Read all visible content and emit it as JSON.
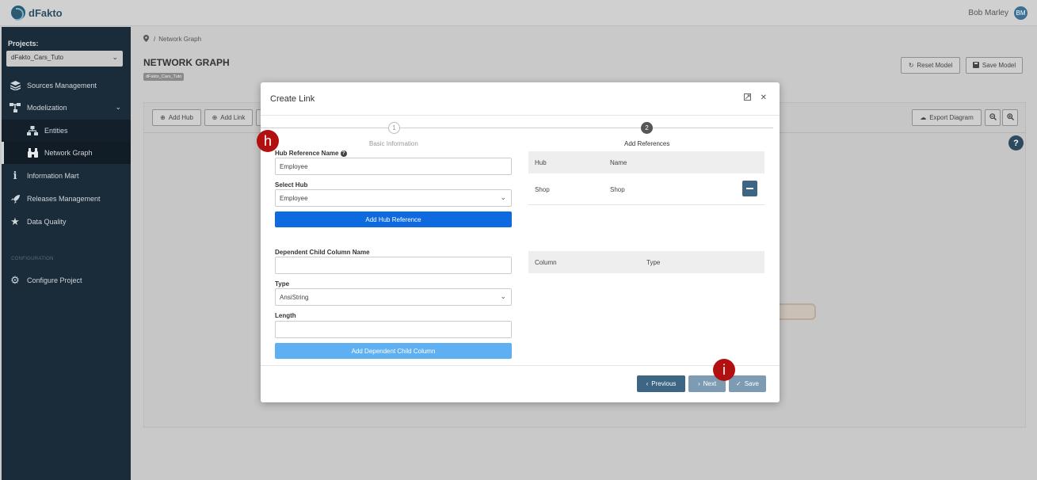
{
  "app": {
    "logo_text": "dFakto"
  },
  "user": {
    "name": "Bob Marley",
    "initials": "BM"
  },
  "sidebar": {
    "projects_label": "Projects:",
    "project_selected": "dFakto_Cars_Tuto",
    "items": [
      {
        "label": "Sources Management",
        "icon": "layers-icon"
      },
      {
        "label": "Modelization",
        "icon": "hierarchy-icon"
      },
      {
        "label": "Entities",
        "icon": "sitemap-icon"
      },
      {
        "label": "Network Graph",
        "icon": "binoculars-icon"
      },
      {
        "label": "Information Mart",
        "icon": "info-icon"
      },
      {
        "label": "Releases Management",
        "icon": "rocket-icon"
      },
      {
        "label": "Data Quality",
        "icon": "star-icon"
      }
    ],
    "section_label": "CONFIGURATION",
    "configure_label": "Configure Project"
  },
  "header": {
    "breadcrumb": "Network Graph",
    "title": "NETWORK GRAPH",
    "project_badge": "dFakto_Cars_Tuto",
    "reset_label": "Reset Model",
    "save_label": "Save Model"
  },
  "toolbar": {
    "add_hub": "Add Hub",
    "add_link": "Add Link",
    "export": "Export Diagram"
  },
  "modal": {
    "title": "Create Link",
    "steps": [
      {
        "num": "1",
        "label": "Basic Information"
      },
      {
        "num": "2",
        "label": "Add References"
      }
    ],
    "hub_ref_label": "Hub Reference Name",
    "hub_ref_value": "Employee",
    "select_hub_label": "Select Hub",
    "select_hub_value": "Employee",
    "add_hub_ref_btn": "Add Hub Reference",
    "dep_child_label": "Dependent Child Column Name",
    "dep_child_value": "",
    "type_label": "Type",
    "type_value": "AnsiString",
    "length_label": "Length",
    "length_value": "",
    "add_dep_btn": "Add Dependent Child Column",
    "ref_table": {
      "headers": [
        "Hub",
        "Name"
      ],
      "rows": [
        {
          "hub": "Shop",
          "name": "Shop"
        }
      ]
    },
    "col_table": {
      "headers": [
        "Column",
        "Type"
      ]
    },
    "previous_btn": "Previous",
    "next_btn": "Next",
    "save_btn": "Save"
  },
  "annotations": {
    "marker_h": "h",
    "marker_i": "i"
  },
  "colors": {
    "sidebar_bg": "#1a2b39",
    "primary": "#0d6adf",
    "primary_light": "#5fb0f3",
    "footer_btn": "#3d6685",
    "marker": "#b20f10"
  }
}
